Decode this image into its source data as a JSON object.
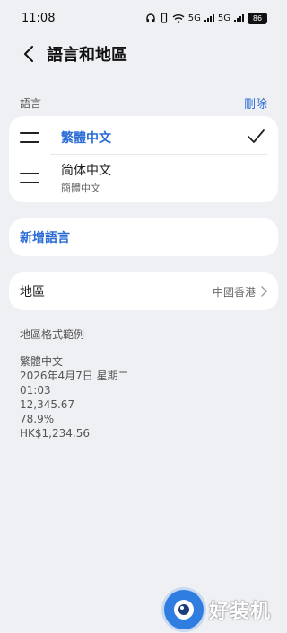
{
  "status_bar": {
    "time": "11:08",
    "net1": "5G",
    "net2": "5G",
    "battery": "86"
  },
  "header": {
    "title": "語言和地區"
  },
  "languages_section": {
    "label": "語言",
    "delete_label": "刪除",
    "items": [
      {
        "name": "繁體中文",
        "sub": "",
        "selected": true
      },
      {
        "name": "简体中文",
        "sub": "簡體中文",
        "selected": false
      }
    ]
  },
  "add_language": {
    "label": "新增語言"
  },
  "region": {
    "label": "地區",
    "value": "中國香港"
  },
  "format_example": {
    "title": "地區格式範例",
    "lines": [
      "繁體中文",
      "2026年4月7日 星期二",
      "01:03",
      "12,345.67",
      "78.9%",
      "HK$1,234.56"
    ]
  },
  "watermark": {
    "text": "好装机"
  },
  "colors": {
    "accent": "#2a6bd6",
    "background": "#eff0f4"
  }
}
